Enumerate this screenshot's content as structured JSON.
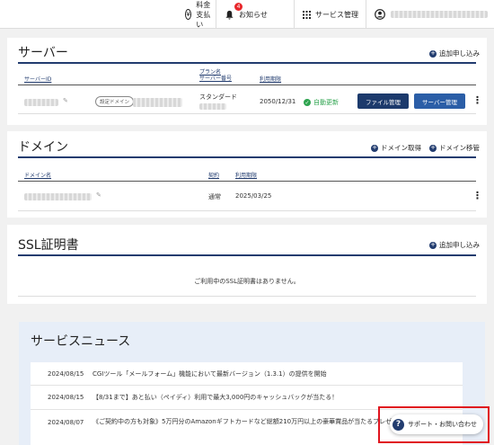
{
  "topbar": {
    "payment": "料金支払い",
    "notice": "お知らせ",
    "notice_badge": "4",
    "service": "サービス管理"
  },
  "server": {
    "title": "サーバー",
    "add": "追加申し込み",
    "headers": {
      "server_id": "サーバーID",
      "plan_line1": "プラン名",
      "plan_line2": "サーバー番号",
      "expiry": "利用期限"
    },
    "row": {
      "tag": "設定ドメイン",
      "plan": "スタンダード",
      "expiry": "2050/12/31",
      "auto_renew": "自動更新",
      "file_btn": "ファイル管理",
      "server_btn": "サーバー管理"
    }
  },
  "domain": {
    "title": "ドメイン",
    "acquire": "ドメイン取得",
    "transfer": "ドメイン移管",
    "headers": {
      "name": "ドメイン名",
      "contract": "契約",
      "expiry": "利用期限"
    },
    "row": {
      "contract": "通常",
      "expiry": "2025/03/25"
    }
  },
  "ssl": {
    "title": "SSL証明書",
    "add": "追加申し込み",
    "empty": "ご利用中のSSL証明書はありません。"
  },
  "news": {
    "title": "サービスニュース",
    "items": [
      {
        "date": "2024/08/15",
        "text": "CGIツール「メールフォーム」機能において最新バージョン（1.3.1）の提供を開始"
      },
      {
        "date": "2024/08/15",
        "text": "【8/31まで】あと払い（ペイディ）利用で最大3,000円のキャッシュバックが当たる！"
      },
      {
        "date": "2024/08/07",
        "text": "《ご契約中の方も対象》5万円分のAmazonギフトカードなど総額210万円以上の豪華賞品が当たるプレゼントキャンペーン"
      }
    ]
  },
  "support": {
    "label": "サポート・お問い合わせ"
  },
  "colors": {
    "navy": "#223c6f",
    "button_blue": "#2b5ea7",
    "green": "#2ea44f",
    "highlight_red": "#e0141e"
  }
}
